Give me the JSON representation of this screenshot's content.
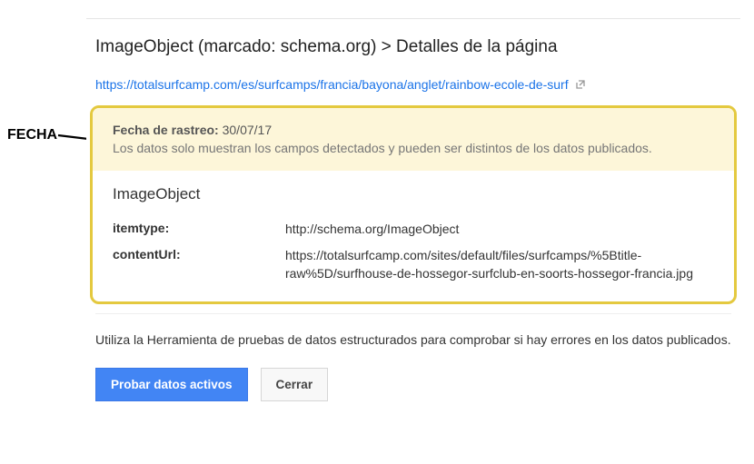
{
  "annotation": {
    "label": "FECHA"
  },
  "breadcrumb": {
    "full": "ImageObject (marcado: schema.org) > Detalles de la página"
  },
  "url": {
    "text": "https://totalsurfcamp.com/es/surfcamps/francia/bayona/anglet/rainbow-ecole-de-surf"
  },
  "crawl": {
    "label": "Fecha de rastreo:",
    "date": "30/07/17",
    "note": "Los datos solo muestran los campos detectados y pueden ser distintos de los datos publicados."
  },
  "object": {
    "title": "ImageObject",
    "fields": [
      {
        "key": "itemtype:",
        "val": "http://schema.org/ImageObject"
      },
      {
        "key": "contentUrl:",
        "val": "https://totalsurfcamp.com/sites/default/files/surfcamps/%5Btitle-raw%5D/surfhouse-de-hossegor-surfclub-en-soorts-hossegor-francia.jpg"
      }
    ]
  },
  "footer": {
    "note": "Utiliza la Herramienta de pruebas de datos estructurados para comprobar si hay errores en los datos publicados."
  },
  "buttons": {
    "primary": "Probar datos activos",
    "secondary": "Cerrar"
  }
}
